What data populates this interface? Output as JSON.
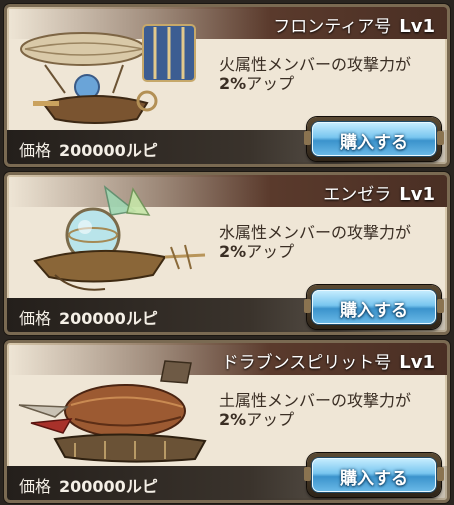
{
  "currency_label": "価格",
  "buy_label": "購入する",
  "ships": [
    {
      "name": "フロンティア号",
      "level": "Lv1",
      "effect_line1": "火属性メンバーの攻撃力が",
      "effect_pct": "2%",
      "effect_suffix": "アップ",
      "price": "200000ルピ",
      "art_icon": "airship-frontier-icon"
    },
    {
      "name": "エンゼラ",
      "level": "Lv1",
      "effect_line1": "水属性メンバーの攻撃力が",
      "effect_pct": "2%",
      "effect_suffix": "アップ",
      "price": "200000ルピ",
      "art_icon": "airship-angela-icon"
    },
    {
      "name": "ドラブンスピリット号",
      "level": "Lv1",
      "effect_line1": "土属性メンバーの攻撃力が",
      "effect_pct": "2%",
      "effect_suffix": "アップ",
      "price": "200000ルピ",
      "art_icon": "airship-drabun-spirit-icon"
    }
  ]
}
